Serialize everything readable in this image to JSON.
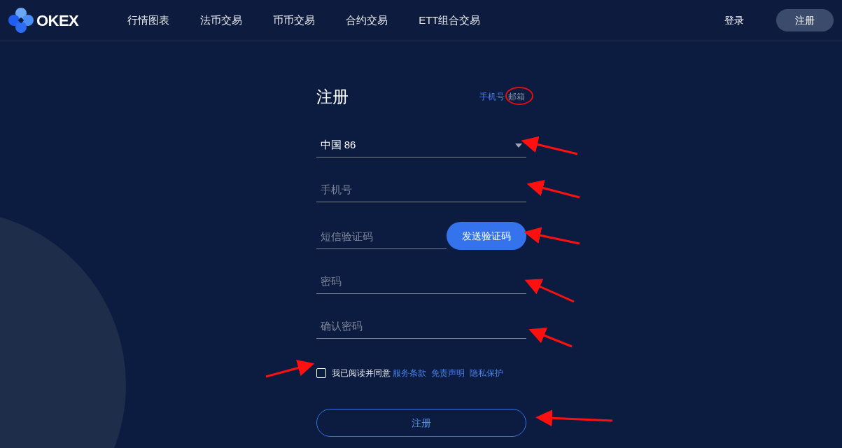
{
  "brand": {
    "name": "OKEX"
  },
  "nav": [
    {
      "label": "行情图表"
    },
    {
      "label": "法币交易"
    },
    {
      "label": "币币交易"
    },
    {
      "label": "合约交易"
    },
    {
      "label": "ETT组合交易"
    }
  ],
  "auth": {
    "login": "登录",
    "register": "注册"
  },
  "form": {
    "title": "注册",
    "tabs": [
      {
        "label": "手机号",
        "selected": true
      },
      {
        "label": "邮箱",
        "selected": false
      }
    ],
    "country": {
      "value": "中国 86"
    },
    "fields": [
      {
        "kind": "text",
        "placeholder": "手机号"
      },
      {
        "kind": "code",
        "placeholder": "短信验证码",
        "button": "发送验证码"
      },
      {
        "kind": "text",
        "placeholder": "密码"
      },
      {
        "kind": "text",
        "placeholder": "确认密码"
      }
    ],
    "agreement": {
      "checked": false,
      "text": "我已阅读并同意",
      "links": [
        "服务条款",
        "免责声明",
        "隐私保护"
      ]
    },
    "submit": "注册"
  }
}
